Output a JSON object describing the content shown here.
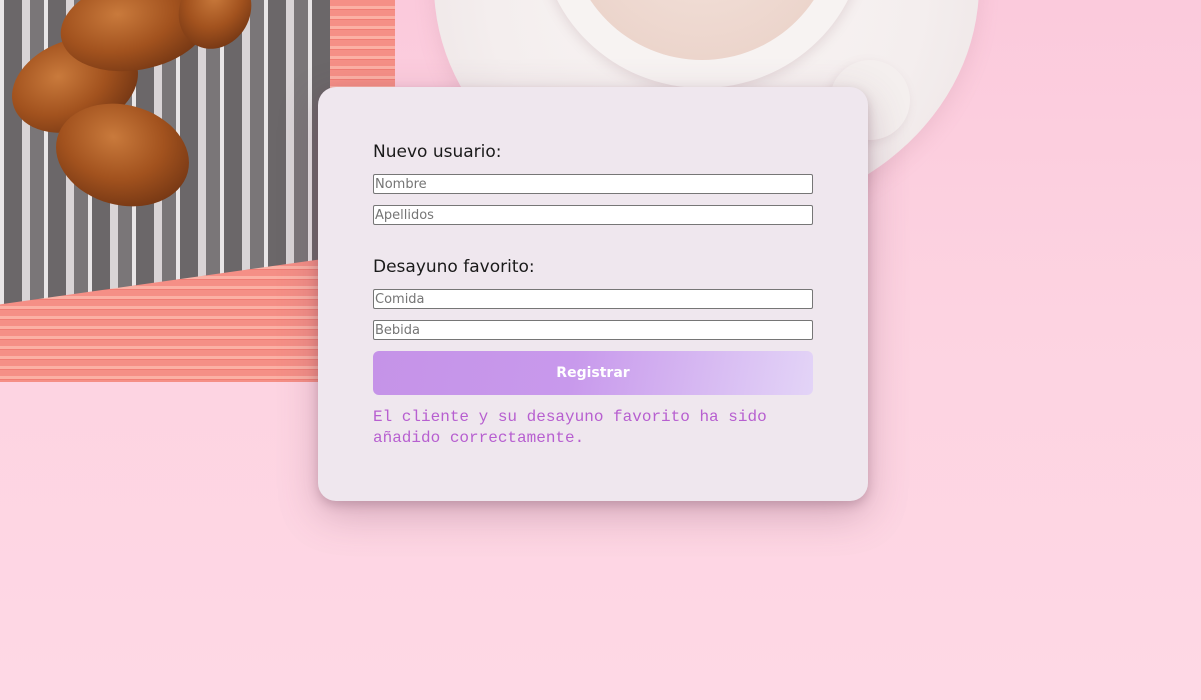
{
  "form": {
    "section_user_label": "Nuevo usuario:",
    "nombre_placeholder": "Nombre",
    "apellidos_placeholder": "Apellidos",
    "section_breakfast_label": "Desayuno favorito:",
    "comida_placeholder": "Comida",
    "bebida_placeholder": "Bebida",
    "submit_label": "Registrar",
    "success_message": "El cliente y su desayuno favorito ha sido añadido correctamente."
  },
  "colors": {
    "background": "#fdd1e0",
    "card": "#efe7ee",
    "button_gradient_start": "#c593e8",
    "button_gradient_end": "#e3d4f7",
    "message_text": "#b75fd0"
  }
}
